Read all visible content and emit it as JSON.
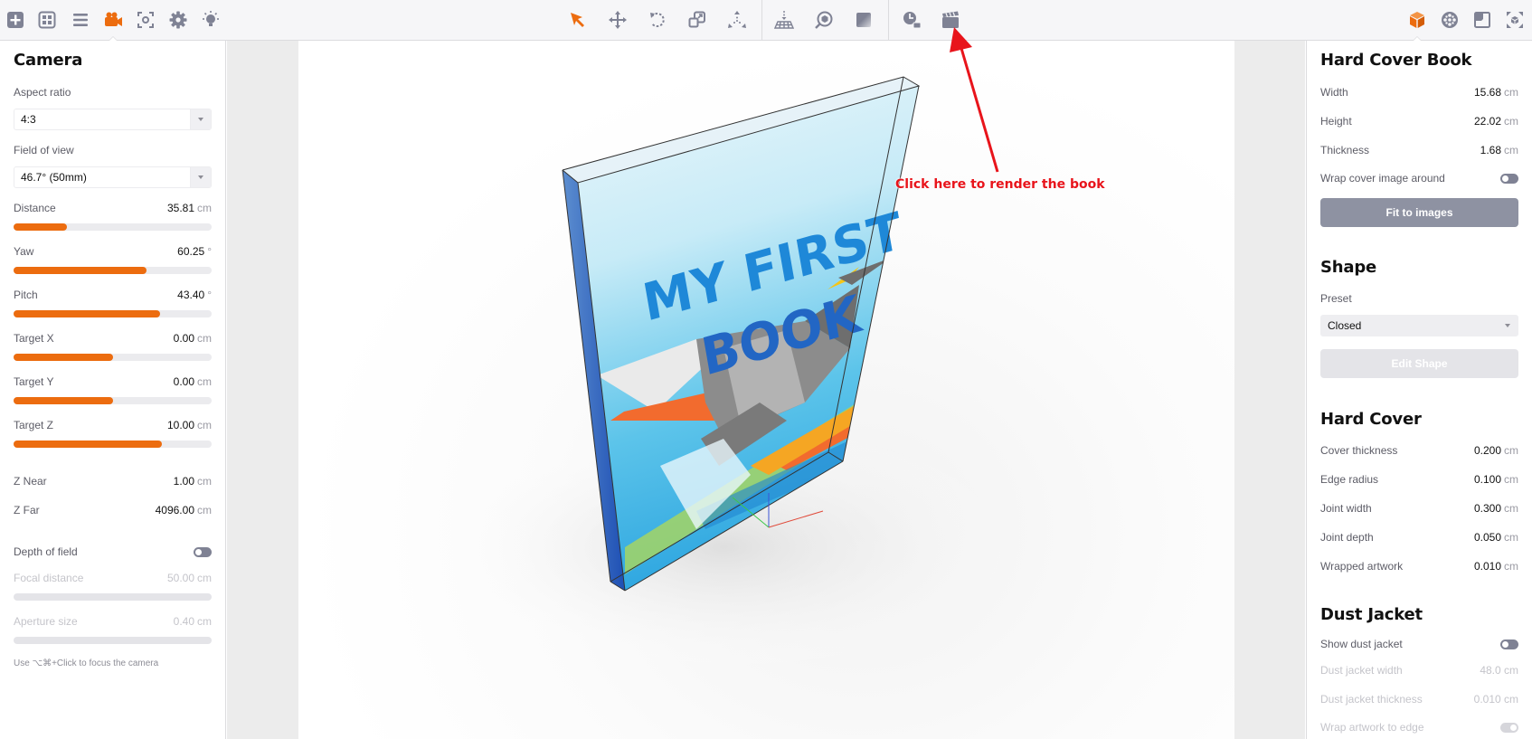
{
  "colors": {
    "accent": "#ec6c0f",
    "annotation": "#e8141b",
    "toggle_off": "#7f8294",
    "button_primary": "#8e92a2"
  },
  "toolbar": {
    "left_icons": [
      "add-icon",
      "grid-layout-icon",
      "menu-lines-icon",
      "camera-icon",
      "focus-frame-icon",
      "gear-icon",
      "light-bulb-icon"
    ],
    "active_left": "camera-icon",
    "center_icons": [
      "select-arrow-icon",
      "move-icon",
      "rotate-icon",
      "scale-icon",
      "explode-icon"
    ],
    "active_center": "select-arrow-icon",
    "view_icons": [
      "ground-plane-icon",
      "zoom-object-icon",
      "gradient-icon"
    ],
    "render_icons": [
      "schedule-render-icon",
      "clapperboard-icon"
    ],
    "right_icons": [
      "box-object-icon",
      "material-sphere-icon",
      "frame-icon",
      "fullscreen-icon"
    ],
    "active_right": "box-object-icon"
  },
  "camera": {
    "title": "Camera",
    "aspect_ratio_label": "Aspect ratio",
    "aspect_ratio_value": "4:3",
    "fov_label": "Field of view",
    "fov_value": "46.7° (50mm)",
    "sliders": [
      {
        "label": "Distance",
        "value": "35.81",
        "unit": "cm",
        "fill": 0.27
      },
      {
        "label": "Yaw",
        "value": "60.25",
        "unit": "°",
        "fill": 0.67
      },
      {
        "label": "Pitch",
        "value": "43.40",
        "unit": "°",
        "fill": 0.74
      },
      {
        "label": "Target X",
        "value": "0.00",
        "unit": "cm",
        "fill": 0.5
      },
      {
        "label": "Target Y",
        "value": "0.00",
        "unit": "cm",
        "fill": 0.5
      },
      {
        "label": "Target Z",
        "value": "10.00",
        "unit": "cm",
        "fill": 0.75
      }
    ],
    "z_near_label": "Z Near",
    "z_near_value": "1.00",
    "z_far_label": "Z Far",
    "z_far_value": "4096.00",
    "unit_cm": "cm",
    "dof_label": "Depth of field",
    "dof_enabled": false,
    "focal_label": "Focal distance",
    "focal_value": "50.00",
    "aperture_label": "Aperture size",
    "aperture_value": "0.40",
    "hint": "Use ⌥⌘+Click to focus the camera"
  },
  "book": {
    "title": "Hard Cover Book",
    "width_label": "Width",
    "width_value": "15.68",
    "height_label": "Height",
    "height_value": "22.02",
    "thickness_label": "Thickness",
    "thickness_value": "1.68",
    "wrap_label": "Wrap cover image around",
    "wrap_enabled": false,
    "fit_button": "Fit to images",
    "unit": "cm"
  },
  "shape": {
    "title": "Shape",
    "preset_label": "Preset",
    "preset_value": "Closed",
    "edit_button": "Edit Shape"
  },
  "hard_cover": {
    "title": "Hard Cover",
    "rows": [
      {
        "label": "Cover thickness",
        "value": "0.200",
        "unit": "cm"
      },
      {
        "label": "Edge radius",
        "value": "0.100",
        "unit": "cm"
      },
      {
        "label": "Joint width",
        "value": "0.300",
        "unit": "cm"
      },
      {
        "label": "Joint depth",
        "value": "0.050",
        "unit": "cm"
      },
      {
        "label": "Wrapped artwork",
        "value": "0.010",
        "unit": "cm"
      }
    ]
  },
  "dust_jacket": {
    "title": "Dust Jacket",
    "show_label": "Show dust jacket",
    "show_enabled": false,
    "width_label": "Dust jacket width",
    "width_value": "48.0 cm",
    "thickness_label": "Dust jacket thickness",
    "thickness_value": "0.010 cm",
    "wrap_label": "Wrap artwork to edge"
  },
  "viewport": {
    "book_cover_title_line1": "MY FIRST",
    "book_cover_title_line2": "BOOK",
    "annotation": "Click here to render the book"
  }
}
